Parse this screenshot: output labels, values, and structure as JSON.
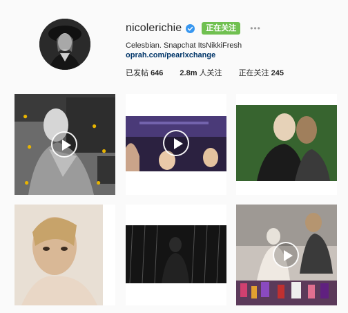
{
  "profile": {
    "username": "nicolerichie",
    "follow_label": "正在关注",
    "more_label": "•••",
    "bio": "Celesbian. Snapchat ItsNikkiFresh",
    "link": "oprah.com/pearlxchange"
  },
  "stats": {
    "posts_label": "已发帖",
    "posts_value": "646",
    "followers_value": "2.8m",
    "followers_label": "人关注",
    "following_label": "正在关注",
    "following_value": "245"
  },
  "colors": {
    "follow_green": "#70c050",
    "verified_blue": "#3897f0",
    "link_blue": "#003569"
  },
  "posts": [
    {
      "icon": "video-play-icon",
      "type": "video"
    },
    {
      "icon": "video-play-icon",
      "type": "video"
    },
    {
      "icon": "",
      "type": "photo"
    },
    {
      "icon": "",
      "type": "photo"
    },
    {
      "icon": "",
      "type": "photo"
    },
    {
      "icon": "video-play-icon",
      "type": "video"
    }
  ]
}
